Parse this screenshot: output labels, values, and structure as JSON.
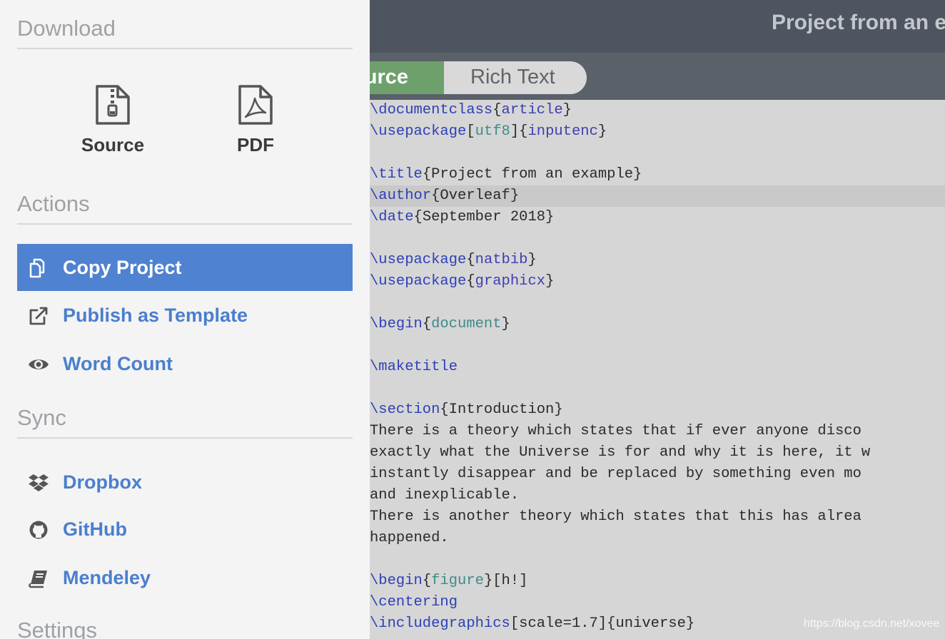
{
  "header": {
    "project_title": "Project from an e"
  },
  "mode_toggle": {
    "source_label": "urce",
    "rich_text_label": "Rich Text"
  },
  "editor": {
    "lines": [
      [
        {
          "t": "\\documentclass",
          "c": "cmd"
        },
        {
          "t": "{"
        },
        {
          "t": "article",
          "c": "arg"
        },
        {
          "t": "}"
        }
      ],
      [
        {
          "t": "\\usepackage",
          "c": "cmd"
        },
        {
          "t": "["
        },
        {
          "t": "utf8",
          "c": "env"
        },
        {
          "t": "]{"
        },
        {
          "t": "inputenc",
          "c": "arg"
        },
        {
          "t": "}"
        }
      ],
      [],
      [
        {
          "t": "\\title",
          "c": "cmd"
        },
        {
          "t": "{Project from an example}"
        }
      ],
      [
        {
          "t": "\\author",
          "c": "cmd"
        },
        {
          "t": "{Overleaf}"
        }
      ],
      [
        {
          "t": "\\date",
          "c": "cmd"
        },
        {
          "t": "{September 2018}"
        }
      ],
      [],
      [
        {
          "t": "\\usepackage",
          "c": "cmd"
        },
        {
          "t": "{"
        },
        {
          "t": "natbib",
          "c": "arg"
        },
        {
          "t": "}"
        }
      ],
      [
        {
          "t": "\\usepackage",
          "c": "cmd"
        },
        {
          "t": "{"
        },
        {
          "t": "graphicx",
          "c": "arg"
        },
        {
          "t": "}"
        }
      ],
      [],
      [
        {
          "t": "\\begin",
          "c": "cmd"
        },
        {
          "t": "{"
        },
        {
          "t": "document",
          "c": "env"
        },
        {
          "t": "}"
        }
      ],
      [],
      [
        {
          "t": "\\maketitle",
          "c": "cmd"
        }
      ],
      [],
      [
        {
          "t": "\\section",
          "c": "cmd"
        },
        {
          "t": "{Introduction}"
        }
      ],
      [
        {
          "t": "There is a theory which states that if ever anyone disco"
        }
      ],
      [
        {
          "t": "exactly what the Universe is for and why it is here, it w"
        }
      ],
      [
        {
          "t": "instantly disappear and be replaced by something even mo"
        }
      ],
      [
        {
          "t": "and inexplicable."
        }
      ],
      [
        {
          "t": "There is another theory which states that this has alrea"
        }
      ],
      [
        {
          "t": "happened."
        }
      ],
      [],
      [
        {
          "t": "\\begin",
          "c": "cmd"
        },
        {
          "t": "{"
        },
        {
          "t": "figure",
          "c": "env"
        },
        {
          "t": "}[h!]"
        }
      ],
      [
        {
          "t": "\\centering",
          "c": "cmd"
        }
      ],
      [
        {
          "t": "\\includegraphics",
          "c": "cmd"
        },
        {
          "t": "[scale=1.7]{universe}"
        }
      ]
    ],
    "active_line": 4
  },
  "watermark": "https://blog.csdn.net/xovee",
  "menu": {
    "download": {
      "header": "Download",
      "items": [
        {
          "label": "Source",
          "icon": "zip-file-icon"
        },
        {
          "label": "PDF",
          "icon": "pdf-file-icon"
        }
      ]
    },
    "actions": {
      "header": "Actions",
      "items": [
        {
          "label": "Copy Project",
          "icon": "copy-icon"
        },
        {
          "label": "Publish as Template",
          "icon": "external-link-icon"
        },
        {
          "label": "Word Count",
          "icon": "eye-icon"
        }
      ]
    },
    "sync": {
      "header": "Sync",
      "items": [
        {
          "label": "Dropbox",
          "icon": "dropbox-icon"
        },
        {
          "label": "GitHub",
          "icon": "github-icon"
        },
        {
          "label": "Mendeley",
          "icon": "book-icon"
        }
      ]
    },
    "settings": {
      "header": "Settings"
    }
  },
  "colors": {
    "menu_accent": "#4f82d0",
    "source_toggle": "#6ea06b",
    "topbar": "#4e5560"
  }
}
